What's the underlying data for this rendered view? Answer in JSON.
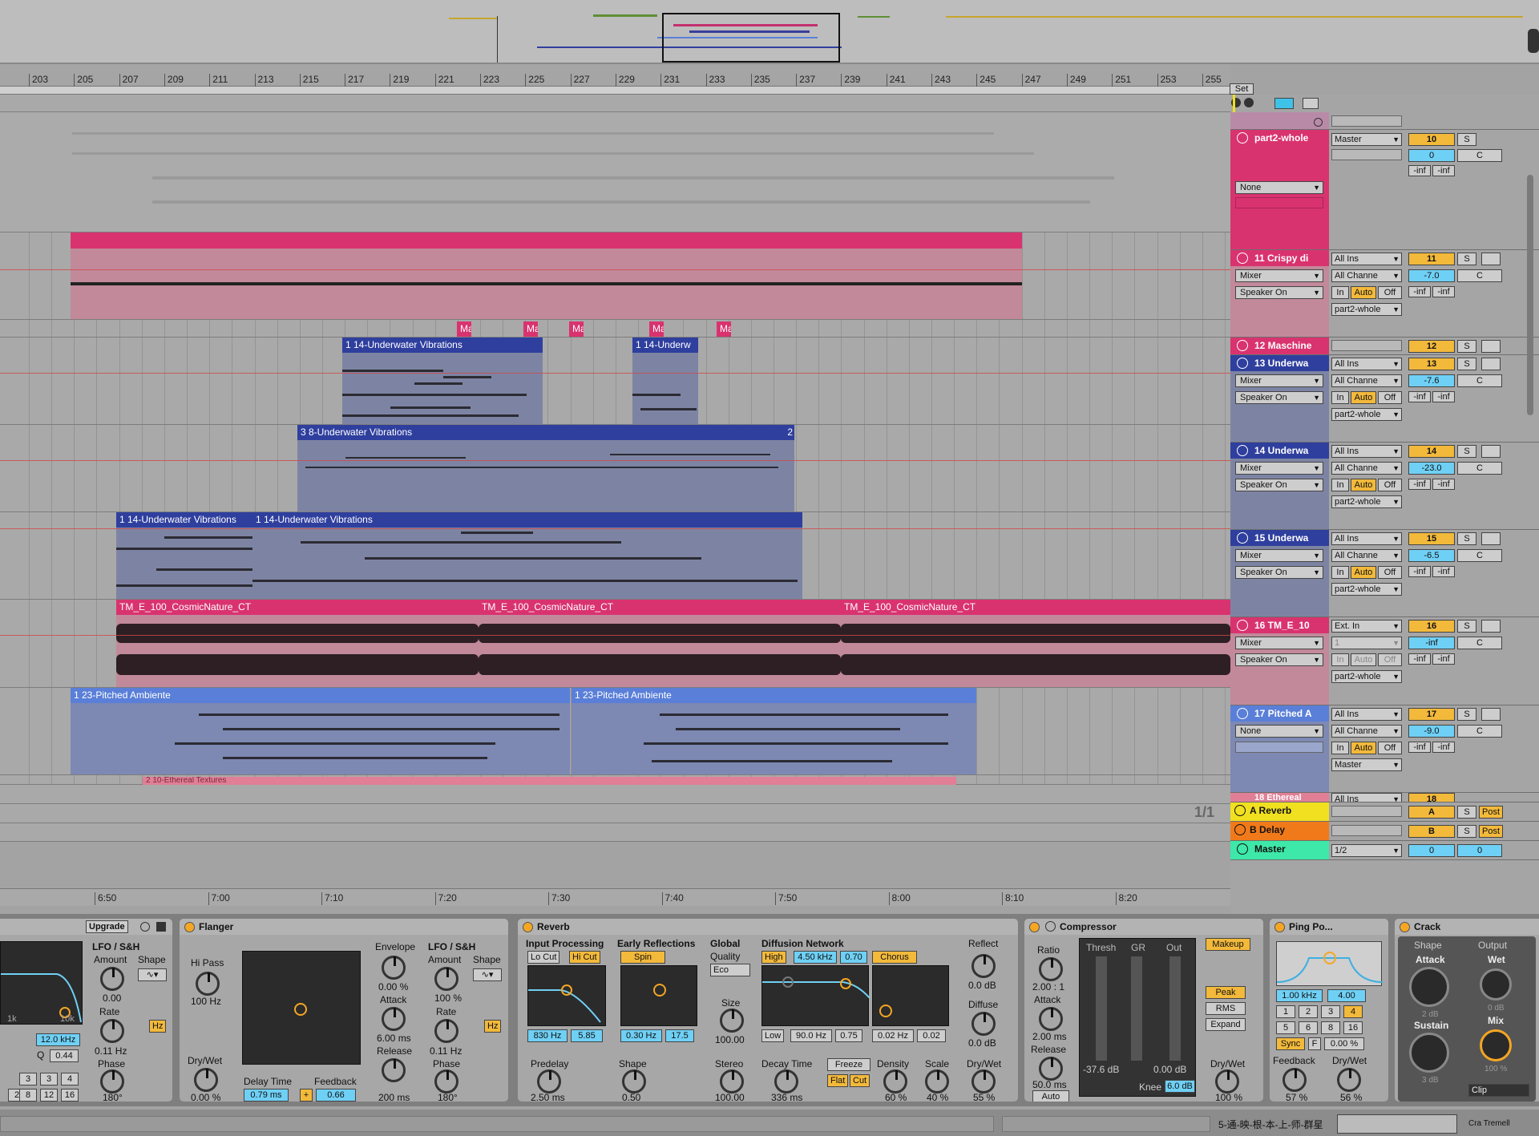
{
  "ruler": {
    "bars": [
      "203",
      "205",
      "207",
      "209",
      "211",
      "213",
      "215",
      "217",
      "219",
      "221",
      "223",
      "225",
      "227",
      "229",
      "231",
      "233",
      "235",
      "237",
      "239",
      "241",
      "243",
      "245",
      "247",
      "249",
      "251",
      "253",
      "255"
    ]
  },
  "set_label": "Set",
  "time_ticks": [
    "6:50",
    "7:00",
    "7:10",
    "7:20",
    "7:30",
    "7:40",
    "7:50",
    "8:00",
    "8:10",
    "8:20"
  ],
  "page_indicator": "1/1",
  "clips": {
    "maschine": "Ma",
    "uw1a": "1 14-Underwater Vibrations",
    "uw1b": "1 14-Underw",
    "uw2": "3 8-Underwater Vibrations",
    "uw2_end": "2",
    "uw3a": "1 14-Underwater Vibrations",
    "uw3b": "1 14-Underwater Vibrations",
    "tm1": "TM_E_100_CosmicNature_CT",
    "tm2": "TM_E_100_CosmicNature_CT",
    "tm3": "TM_E_100_CosmicNature_CT",
    "pa1": "1 23-Pitched Ambiente",
    "pa2": "1 23-Pitched Ambiente",
    "eth": "2 10-Ethereal Textures"
  },
  "mixer": {
    "part2": {
      "name": "part2-whole",
      "out": "Master",
      "num": "10",
      "solo": "S",
      "vol": "0",
      "pan": "C",
      "inf1": "-inf",
      "inf2": "-inf",
      "route": "None"
    },
    "t11": {
      "name": "11 Crispy di",
      "in": "All Ins",
      "mixer": "Mixer",
      "chan": "All Channe",
      "speaker": "Speaker On",
      "inb": "In",
      "auto": "Auto",
      "off": "Off",
      "out": "part2-whole",
      "num": "11",
      "solo": "S",
      "vol": "-7.0",
      "pan": "C",
      "inf1": "-inf",
      "inf2": "-inf"
    },
    "t12": {
      "name": "12 Maschine",
      "num": "12",
      "solo": "S"
    },
    "t13": {
      "name": "13 Underwa",
      "in": "All Ins",
      "mixer": "Mixer",
      "chan": "All Channe",
      "speaker": "Speaker On",
      "inb": "In",
      "auto": "Auto",
      "off": "Off",
      "out": "part2-whole",
      "num": "13",
      "solo": "S",
      "vol": "-7.6",
      "pan": "C",
      "inf1": "-inf",
      "inf2": "-inf"
    },
    "t14": {
      "name": "14 Underwa",
      "in": "All Ins",
      "mixer": "Mixer",
      "chan": "All Channe",
      "speaker": "Speaker On",
      "inb": "In",
      "auto": "Auto",
      "off": "Off",
      "out": "part2-whole",
      "num": "14",
      "solo": "S",
      "vol": "-23.0",
      "pan": "C",
      "inf1": "-inf",
      "inf2": "-inf"
    },
    "t15": {
      "name": "15 Underwa",
      "in": "All Ins",
      "mixer": "Mixer",
      "chan": "All Channe",
      "speaker": "Speaker On",
      "inb": "In",
      "auto": "Auto",
      "off": "Off",
      "out": "part2-whole",
      "num": "15",
      "solo": "S",
      "vol": "-6.5",
      "pan": "C",
      "inf1": "-inf",
      "inf2": "-inf"
    },
    "t16": {
      "name": "16 TM_E_10",
      "in": "Ext. In",
      "mixer": "Mixer",
      "chan": "1",
      "speaker": "Speaker On",
      "inb": "In",
      "auto": "Auto",
      "off": "Off",
      "out": "part2-whole",
      "num": "16",
      "solo": "S",
      "vol": "-inf",
      "pan": "C",
      "inf1": "-inf",
      "inf2": "-inf"
    },
    "t17": {
      "name": "17 Pitched A",
      "in": "All Ins",
      "mixer": "None",
      "chan": "All Channe",
      "inb": "In",
      "auto": "Auto",
      "off": "Off",
      "out": "Master",
      "num": "17",
      "solo": "S",
      "vol": "-9.0",
      "pan": "C",
      "inf1": "-inf",
      "inf2": "-inf"
    },
    "t18": {
      "name": "18 Ethereal",
      "in": "All Ins",
      "num": "18"
    },
    "ra": {
      "name": "A Reverb",
      "num": "A",
      "solo": "S",
      "post": "Post"
    },
    "rb": {
      "name": "B Delay",
      "num": "B",
      "solo": "S",
      "post": "Post"
    },
    "master": {
      "name": "Master",
      "out": "1/2",
      "vol": "0",
      "pan": "0"
    }
  },
  "devices": {
    "first": {
      "upgrade": "Upgrade",
      "lfo": "LFO / S&H",
      "amount": "Amount",
      "shape": "Shape",
      "amount_val": "0.00",
      "rate": "Rate",
      "rate_val": "0.11 Hz",
      "hz": "Hz",
      "phase": "Phase",
      "phase_val": "180°",
      "freq": "12.0 kHz",
      "q": "Q",
      "q_val": "0.44",
      "k1": "1k",
      "k10": "10k",
      "n1": "1",
      "n2": "2",
      "n3": "3",
      "n4": "4",
      "n8": "8",
      "n12": "12",
      "n16": "16"
    },
    "flanger": {
      "title": "Flanger",
      "hipass": "Hi Pass",
      "hipass_val": "100 Hz",
      "drywet": "Dry/Wet",
      "drywet_val": "0.00 %",
      "delay": "Delay Time",
      "delay_val": "0.79 ms",
      "feedback": "Feedback",
      "feedback_val": "0.66",
      "plus": "+",
      "envelope": "Envelope",
      "env_val": "0.00 %",
      "attack": "Attack",
      "attack_val": "6.00 ms",
      "release": "Release",
      "release_val": "200 ms",
      "lfo": "LFO / S&H",
      "amount": "Amount",
      "shape": "Shape",
      "amount_val": "100 %",
      "rate": "Rate",
      "rate_val": "0.11 Hz",
      "phase": "Phase",
      "phase_val": "180°",
      "hz": "Hz"
    },
    "reverb": {
      "title": "Reverb",
      "input": "Input Processing",
      "locut": "Lo Cut",
      "hicut": "Hi Cut",
      "f1": "830 Hz",
      "f2": "5.85",
      "early": "Early Reflections",
      "spin": "Spin",
      "e1": "0.30 Hz",
      "e2": "17.5",
      "global": "Global",
      "quality": "Quality",
      "eco": "Eco",
      "size": "Size",
      "size_val": "100.00",
      "predelay": "Predelay",
      "predelay_val": "2.50 ms",
      "shape": "Shape",
      "shape_val": "0.50",
      "stereo": "Stereo",
      "stereo_val": "100.00",
      "diff": "Diffusion Network",
      "high": "High",
      "d_freq": "4.50 kHz",
      "d_val": "0.70",
      "chorus": "Chorus",
      "low": "Low",
      "l_freq": "90.0 Hz",
      "l_val": "0.75",
      "c1": "0.02 Hz",
      "c2": "0.02",
      "decay": "Decay Time",
      "decay_val": "336 ms",
      "freeze": "Freeze",
      "flat": "Flat",
      "cut": "Cut",
      "density": "Density",
      "density_val": "60 %",
      "scale": "Scale",
      "scale_val": "40 %",
      "reflect": "Reflect",
      "reflect_val": "0.0 dB",
      "diffuse": "Diffuse",
      "diffuse_val": "0.0 dB",
      "drywet": "Dry/Wet",
      "drywet_val": "55 %"
    },
    "comp": {
      "title": "Compressor",
      "ratio": "Ratio",
      "ratio_val": "2.00 : 1",
      "attack": "Attack",
      "attack_val": "2.00 ms",
      "release": "Release",
      "release_val": "50.0 ms",
      "auto": "Auto",
      "thresh": "Thresh",
      "gr": "GR",
      "out": "Out",
      "makeup": "Makeup",
      "peak": "Peak",
      "rms": "RMS",
      "expand": "Expand",
      "thresh_val": "-37.6 dB",
      "out_val": "0.00 dB",
      "knee": "Knee",
      "knee_val": "6.0 dB",
      "drywet": "Dry/Wet",
      "drywet_val": "100 %"
    },
    "ping": {
      "title": "Ping Po...",
      "freq": "1.00 kHz",
      "q": "4.00",
      "b1": "1",
      "b2": "2",
      "b3": "3",
      "b4": "4",
      "b5": "5",
      "b6": "6",
      "b8": "8",
      "b16": "16",
      "sync": "Sync",
      "f": "F",
      "pct": "0.00 %",
      "feedback": "Feedback",
      "feedback_val": "57 %",
      "drywet": "Dry/Wet",
      "drywet_val": "56 %"
    },
    "crack": {
      "title": "Crack",
      "shape": "Shape",
      "output": "Output",
      "attack": "Attack",
      "wet": "Wet",
      "attack_val": "2 dB",
      "wet_val": "0 dB",
      "sustain": "Sustain",
      "mix": "Mix",
      "sustain_val": "3 dB",
      "mix_val": "100 %",
      "clip": "Clip"
    }
  },
  "status": {
    "text": "5-通-映-根-本-上-师-群星",
    "right": "Cra Tremell"
  },
  "colors": {
    "pink": "#d9336f",
    "blue": "#2f3f9e",
    "lightblue": "#5a7fd8",
    "orange": "#f2b93b",
    "cyan": "#6fd0f5"
  }
}
